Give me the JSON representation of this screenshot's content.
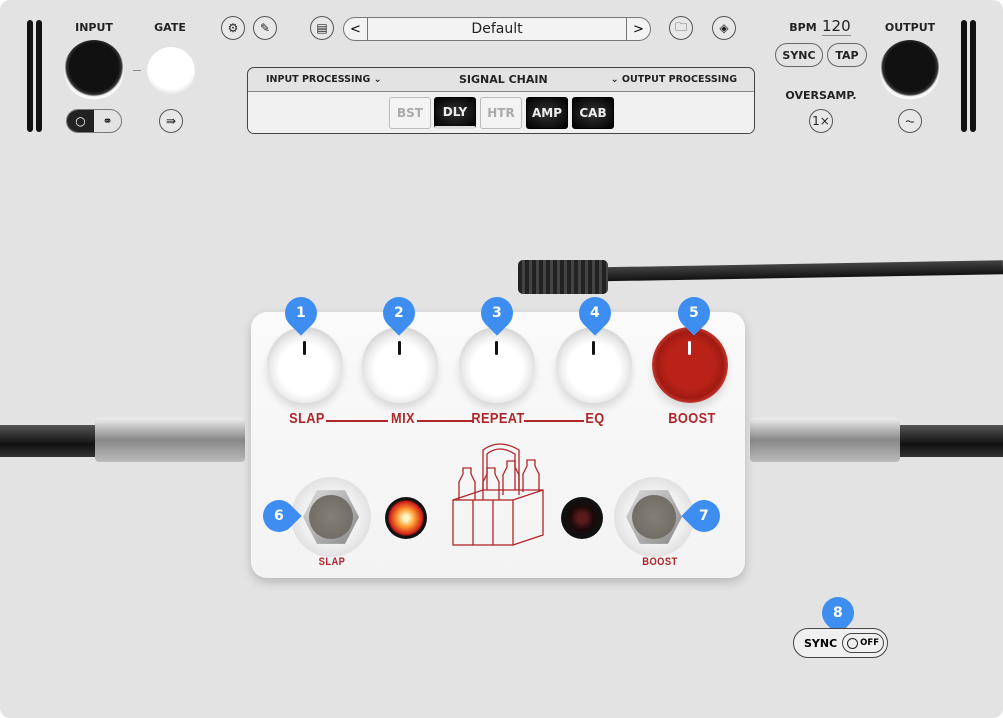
{
  "header": {
    "input_label": "INPUT",
    "gate_label": "GATE",
    "preset_name": "Default",
    "prev_label": "<",
    "next_label": ">",
    "bpm_label": "BPM",
    "bpm_value": "120",
    "sync_label": "SYNC",
    "tap_label": "TAP",
    "oversamp_label": "OVERSAMP.",
    "oversamp_value": "1×",
    "output_label": "OUTPUT"
  },
  "signal_chain": {
    "title": "SIGNAL CHAIN",
    "input_processing": "INPUT PROCESSING ⌄",
    "output_processing": "⌄ OUTPUT PROCESSING",
    "modules": [
      {
        "label": "BST",
        "active": false
      },
      {
        "label": "DLY",
        "active": true
      },
      {
        "label": "HTR",
        "active": false
      },
      {
        "label": "AMP",
        "active": true
      },
      {
        "label": "CAB",
        "active": true
      }
    ]
  },
  "pedal": {
    "knobs": [
      "SLAP",
      "MIX",
      "REPEAT",
      "EQ",
      "BOOST"
    ],
    "footswitches": [
      "SLAP",
      "BOOST"
    ],
    "led_slap_on": true,
    "led_boost_on": false,
    "accent_color": "#b0262a"
  },
  "markers": [
    "1",
    "2",
    "3",
    "4",
    "5",
    "6",
    "7",
    "8"
  ],
  "sync_toggle": {
    "label": "SYNC",
    "state": "OFF"
  },
  "colors": {
    "marker": "#3e8ef2",
    "background": "#e3e3e3"
  }
}
